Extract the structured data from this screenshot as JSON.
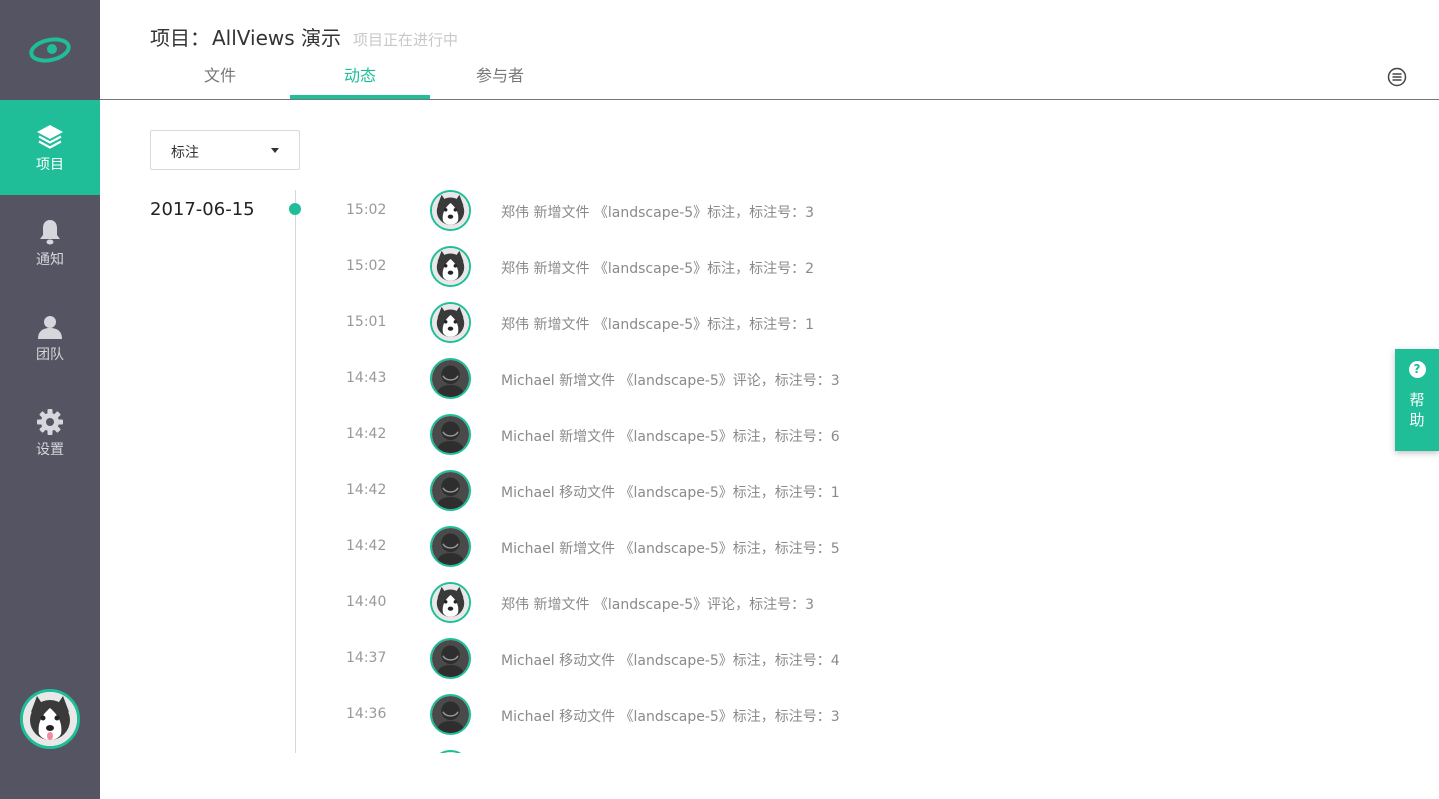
{
  "app": {
    "accent": "#1fbe98",
    "sidebar_bg": "#545462"
  },
  "sidebar": {
    "items": [
      {
        "label": "项目",
        "icon": "layers-icon",
        "active": true
      },
      {
        "label": "通知",
        "icon": "bell-icon",
        "active": false
      },
      {
        "label": "团队",
        "icon": "team-icon",
        "active": false
      },
      {
        "label": "设置",
        "icon": "gear-icon",
        "active": false
      }
    ]
  },
  "header": {
    "title_prefix": "项目：",
    "project_name": "AllViews 演示",
    "status": "项目正在进行中",
    "tabs": [
      {
        "label": "文件",
        "active": false
      },
      {
        "label": "动态",
        "active": true
      },
      {
        "label": "参与者",
        "active": false
      }
    ]
  },
  "filter": {
    "selected": "标注"
  },
  "timeline": {
    "date": "2017-06-15",
    "events": [
      {
        "time": "15:02",
        "user": "zhengwei",
        "text": "郑伟 新增文件 《landscape-5》标注，标注号：3"
      },
      {
        "time": "15:02",
        "user": "zhengwei",
        "text": "郑伟 新增文件 《landscape-5》标注，标注号：2"
      },
      {
        "time": "15:01",
        "user": "zhengwei",
        "text": "郑伟 新增文件 《landscape-5》标注，标注号：1"
      },
      {
        "time": "14:43",
        "user": "michael",
        "text": "Michael 新增文件 《landscape-5》评论，标注号：3"
      },
      {
        "time": "14:42",
        "user": "michael",
        "text": "Michael 新增文件 《landscape-5》标注，标注号：6"
      },
      {
        "time": "14:42",
        "user": "michael",
        "text": "Michael 移动文件 《landscape-5》标注，标注号：1"
      },
      {
        "time": "14:42",
        "user": "michael",
        "text": "Michael 新增文件 《landscape-5》标注，标注号：5"
      },
      {
        "time": "14:40",
        "user": "zhengwei",
        "text": "郑伟 新增文件 《landscape-5》评论，标注号：3"
      },
      {
        "time": "14:37",
        "user": "michael",
        "text": "Michael 移动文件 《landscape-5》标注，标注号：4"
      },
      {
        "time": "14:36",
        "user": "michael",
        "text": "Michael 移动文件 《landscape-5》标注，标注号：3"
      },
      {
        "time": "",
        "user": "zhengwei",
        "text": ""
      }
    ]
  },
  "help": {
    "label": "帮助",
    "icon": "question-icon"
  }
}
